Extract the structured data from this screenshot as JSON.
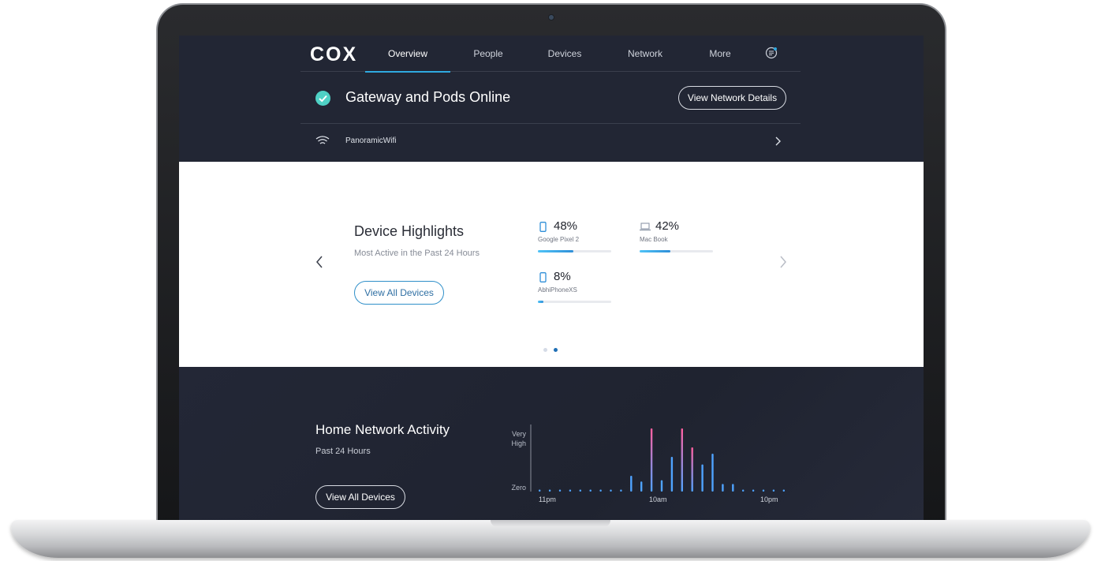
{
  "brand": {
    "logo": "COX",
    "accent": "#2fa9e0",
    "success": "#4fd1c5"
  },
  "nav": {
    "items": [
      {
        "label": "Overview",
        "active": true
      },
      {
        "label": "People",
        "active": false
      },
      {
        "label": "Devices",
        "active": false
      },
      {
        "label": "Network",
        "active": false
      },
      {
        "label": "More",
        "active": false
      }
    ],
    "chat_icon": "chat-list-icon"
  },
  "status": {
    "title": "Gateway and Pods Online",
    "icon": "check-circle-icon",
    "button_label": "View Network Details"
  },
  "wifi": {
    "icon": "wifi-icon",
    "name": "PanoramicWifi"
  },
  "highlights": {
    "title": "Device Highlights",
    "subtitle": "Most Active in the Past 24 Hours",
    "button_label": "View All Devices",
    "devices": [
      {
        "icon": "phone-icon",
        "percent_label": "48%",
        "percent": 48,
        "name": "Google Pixel 2"
      },
      {
        "icon": "laptop-icon",
        "percent_label": "42%",
        "percent": 42,
        "name": "Mac Book"
      },
      {
        "icon": "phone-icon",
        "percent_label": "8%",
        "percent": 8,
        "name": "AbhiPhoneXS"
      }
    ],
    "pages": 2,
    "active_page": 2
  },
  "activity": {
    "title": "Home Network Activity",
    "subtitle": "Past 24 Hours",
    "button_label": "View All Devices"
  },
  "chart_data": {
    "type": "bar",
    "y_labels": [
      "Very\nHigh",
      "Zero"
    ],
    "x_labels": [
      "11pm",
      "10am",
      "10pm"
    ],
    "ylim": [
      0,
      100
    ],
    "values": [
      2,
      2,
      2,
      2,
      2,
      2,
      2,
      2,
      2,
      25,
      16,
      100,
      18,
      55,
      100,
      70,
      43,
      60,
      12,
      12,
      2,
      2,
      2,
      2,
      2
    ],
    "colors": {
      "low": "#4fa3ff",
      "high": "#ff5fa0"
    }
  }
}
